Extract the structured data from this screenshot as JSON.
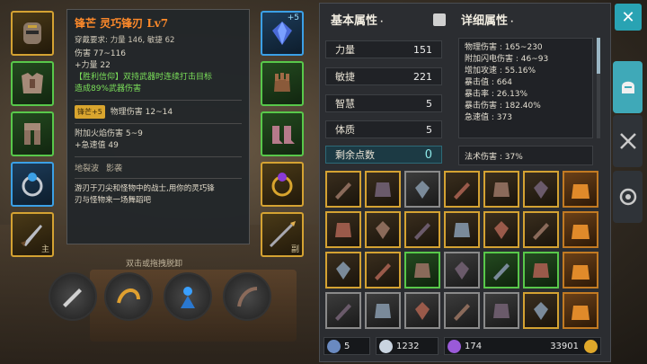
{
  "tooltip": {
    "title": "锋芒 灵巧锋刃 Lv7",
    "requirement": "穿戴要求:     力量 146, 敏捷 62",
    "damage": "伤害   77~116",
    "str_bonus": "+力量 22",
    "passive_1": "【胜利信仰】双持武器时连续打击目标",
    "passive_2": "造成89%武器伤害",
    "badge": "锋芒+5",
    "physical": "物理伤害 12~14",
    "fire": "附加火焰伤害  5~9",
    "crit": "+急速值  49",
    "set_1": "地裂波",
    "set_2": "影袭",
    "desc_1": "游刃于刀尖和怪物中的战士,用你的灵巧锋",
    "desc_2": "刃与怪物来一场舞蹈吧"
  },
  "hint": "双击或拖拽脱卸",
  "slots": {
    "top_right_plus": "+5",
    "tag_left": "主",
    "tag_right": "副"
  },
  "basic": {
    "title": "基本属性",
    "str_label": "力量",
    "str_val": "151",
    "agi_label": "敏捷",
    "agi_val": "221",
    "int_label": "智慧",
    "int_val": "5",
    "con_label": "体质",
    "con_val": "5",
    "remain_label": "剩余点数",
    "remain_val": "0"
  },
  "detail": {
    "title": "详细属性",
    "lines": [
      "物理伤害 : 165~230",
      "附加闪电伤害 : 46~93",
      "增加攻速 : 55.16%",
      "暴击值 : 664",
      "暴击率 : 26.13%",
      "暴击伤害 : 182.40%",
      "急速值 : 373"
    ],
    "magic": "法术伤害 : 37%"
  },
  "currency": {
    "swords": "5",
    "gems": "1232",
    "crystals": "174",
    "gold": "33901"
  },
  "colors": {
    "accent": "#29a3b3",
    "gold": "#d4a232",
    "orange_title": "#ff8a2a",
    "green_text": "#7be05a"
  }
}
